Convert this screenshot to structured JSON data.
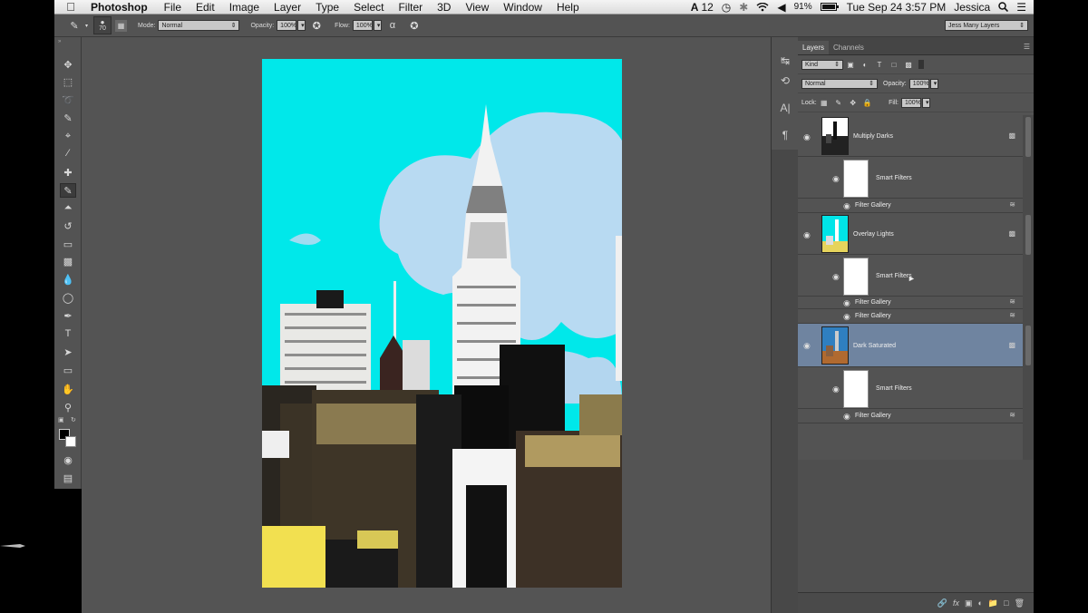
{
  "menubar": {
    "app_name": "Photoshop",
    "items": [
      "File",
      "Edit",
      "Image",
      "Layer",
      "Type",
      "Select",
      "Filter",
      "3D",
      "View",
      "Window",
      "Help"
    ],
    "adobe_badge": "12",
    "battery": "91%",
    "datetime": "Tue Sep 24  3:57 PM",
    "user": "Jessica"
  },
  "options": {
    "brush_size": "70",
    "mode_label": "Mode:",
    "mode_value": "Normal",
    "opacity_label": "Opacity:",
    "opacity_value": "100%",
    "flow_label": "Flow:",
    "flow_value": "100%",
    "workspace": "Jess Many Layers"
  },
  "layers_panel": {
    "tabs": [
      "Layers",
      "Channels"
    ],
    "filter_kind": "Kind",
    "blend_mode": "Normal",
    "opacity_label": "Opacity:",
    "opacity_value": "100%",
    "lock_label": "Lock:",
    "fill_label": "Fill:",
    "fill_value": "100%",
    "layers": [
      {
        "name": "Multiply Darks",
        "smart_filters": "Smart Filters",
        "filters": [
          "Filter Gallery"
        ]
      },
      {
        "name": "Overlay Lights",
        "smart_filters": "Smart Filters",
        "filters": [
          "Filter Gallery",
          "Filter Gallery"
        ]
      },
      {
        "name": "Dark Saturated",
        "smart_filters": "Smart Filters",
        "filters": [
          "Filter Gallery"
        ]
      }
    ],
    "selected_layer": "Dark Saturated"
  },
  "icons": {
    "tools": [
      "move-icon",
      "marquee-icon",
      "lasso-icon",
      "quick-select-icon",
      "crop-icon",
      "eyedropper-icon",
      "healing-icon",
      "brush-icon",
      "stamp-icon",
      "history-brush-icon",
      "eraser-icon",
      "gradient-icon",
      "blur-icon",
      "dodge-icon",
      "pen-icon",
      "type-icon",
      "path-select-icon",
      "shape-icon",
      "hand-icon",
      "zoom-icon"
    ]
  },
  "colors": {
    "ui_dark": "#535353",
    "selection": "#6f84a0",
    "canvas_sky": "#00e5e8"
  }
}
